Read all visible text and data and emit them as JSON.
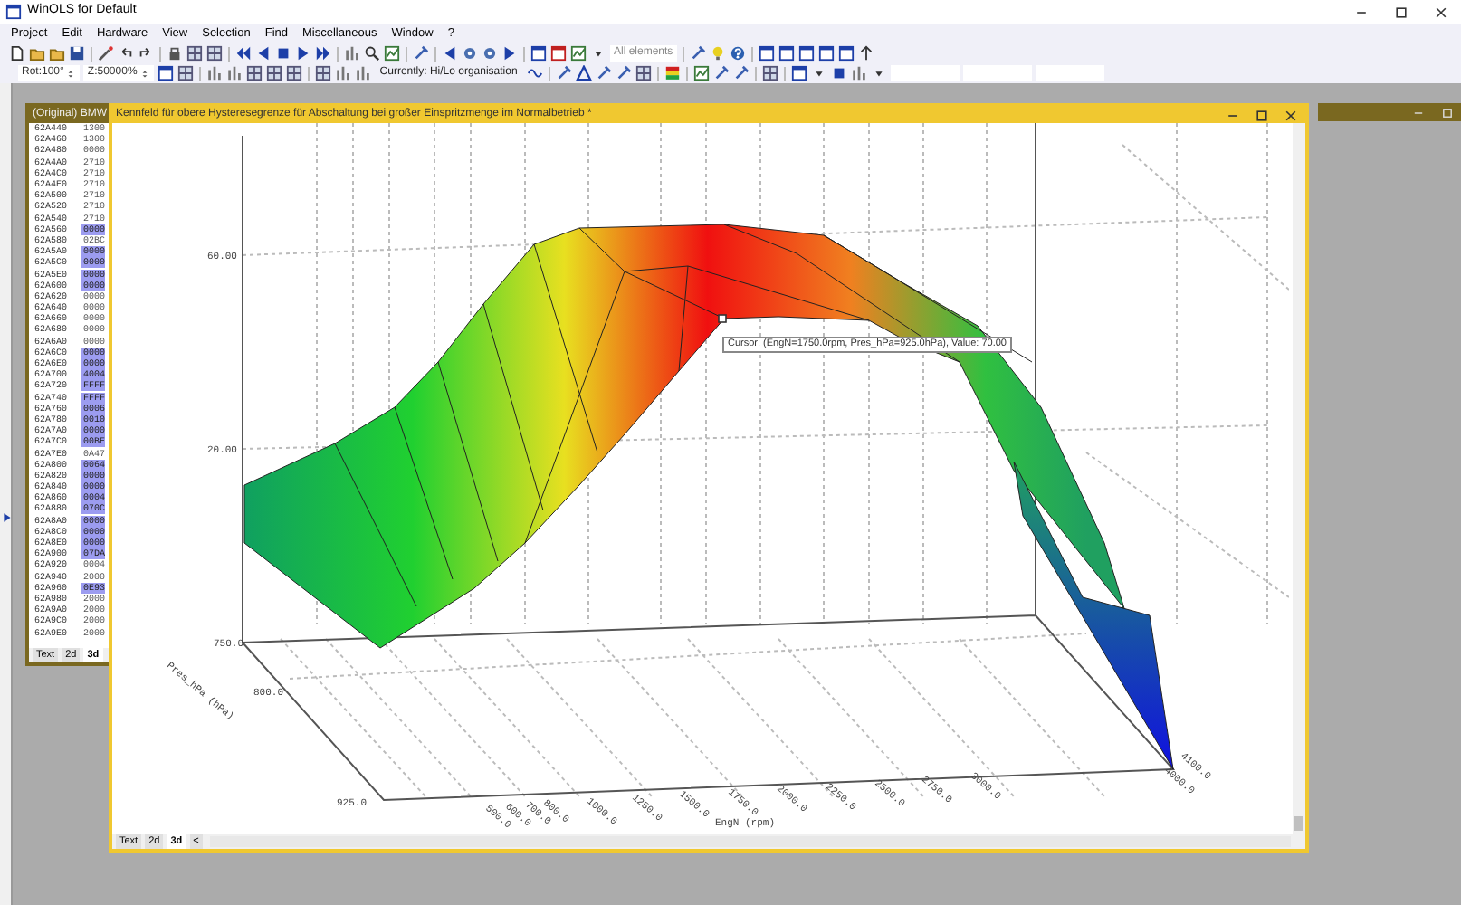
{
  "app": {
    "title": "WinOLS for Default"
  },
  "menu": [
    "Project",
    "Edit",
    "Hardware",
    "View",
    "Selection",
    "Find",
    "Miscellaneous",
    "Window",
    "?"
  ],
  "toolbar": {
    "element_filter": "All elements",
    "rotation": "Rot:100°",
    "zoom": "Z:50000%",
    "organisation": "Currently: Hi/Lo organisation"
  },
  "hex_window": {
    "title": "(Original) BMW",
    "rows": [
      {
        "address": "62A440",
        "value": "1300",
        "selected": false
      },
      {
        "address": "62A460",
        "value": "1300",
        "selected": false
      },
      {
        "address": "62A480",
        "value": "0000",
        "selected": false
      },
      {
        "address": "62A4A0",
        "value": "2710",
        "selected": false
      },
      {
        "address": "62A4C0",
        "value": "2710",
        "selected": false
      },
      {
        "address": "62A4E0",
        "value": "2710",
        "selected": false
      },
      {
        "address": "62A500",
        "value": "2710",
        "selected": false
      },
      {
        "address": "62A520",
        "value": "2710",
        "selected": false
      },
      {
        "address": "62A540",
        "value": "2710",
        "selected": false
      },
      {
        "address": "62A560",
        "value": "0000",
        "selected": true
      },
      {
        "address": "62A580",
        "value": "02BC",
        "selected": false
      },
      {
        "address": "62A5A0",
        "value": "0000",
        "selected": true
      },
      {
        "address": "62A5C0",
        "value": "0000",
        "selected": true
      },
      {
        "address": "62A5E0",
        "value": "0000",
        "selected": true
      },
      {
        "address": "62A600",
        "value": "0000",
        "selected": true
      },
      {
        "address": "62A620",
        "value": "0000",
        "selected": false
      },
      {
        "address": "62A640",
        "value": "0000",
        "selected": false
      },
      {
        "address": "62A660",
        "value": "0000",
        "selected": false
      },
      {
        "address": "62A680",
        "value": "0000",
        "selected": false
      },
      {
        "address": "62A6A0",
        "value": "0000",
        "selected": false
      },
      {
        "address": "62A6C0",
        "value": "0000",
        "selected": true
      },
      {
        "address": "62A6E0",
        "value": "0000",
        "selected": true
      },
      {
        "address": "62A700",
        "value": "4004",
        "selected": true
      },
      {
        "address": "62A720",
        "value": "FFFF",
        "selected": true
      },
      {
        "address": "62A740",
        "value": "FFFF",
        "selected": true
      },
      {
        "address": "62A760",
        "value": "0006",
        "selected": true
      },
      {
        "address": "62A780",
        "value": "0010",
        "selected": true
      },
      {
        "address": "62A7A0",
        "value": "0000",
        "selected": true
      },
      {
        "address": "62A7C0",
        "value": "00BE",
        "selected": true
      },
      {
        "address": "62A7E0",
        "value": "0A47",
        "selected": false
      },
      {
        "address": "62A800",
        "value": "0064",
        "selected": true
      },
      {
        "address": "62A820",
        "value": "0000",
        "selected": true
      },
      {
        "address": "62A840",
        "value": "0000",
        "selected": true
      },
      {
        "address": "62A860",
        "value": "0004",
        "selected": true
      },
      {
        "address": "62A880",
        "value": "070C",
        "selected": true
      },
      {
        "address": "62A8A0",
        "value": "0000",
        "selected": true
      },
      {
        "address": "62A8C0",
        "value": "0000",
        "selected": true
      },
      {
        "address": "62A8E0",
        "value": "0000",
        "selected": true
      },
      {
        "address": "62A900",
        "value": "07DA",
        "selected": true
      },
      {
        "address": "62A920",
        "value": "0004",
        "selected": false
      },
      {
        "address": "62A940",
        "value": "2000",
        "selected": false
      },
      {
        "address": "62A960",
        "value": "0E93",
        "selected": true
      },
      {
        "address": "62A980",
        "value": "2000",
        "selected": false
      },
      {
        "address": "62A9A0",
        "value": "2000",
        "selected": false
      },
      {
        "address": "62A9C0",
        "value": "2000",
        "selected": false
      },
      {
        "address": "62A9E0",
        "value": "2000",
        "selected": false
      }
    ],
    "tabs": [
      {
        "label": "Text",
        "selected": false
      },
      {
        "label": "2d",
        "selected": false
      },
      {
        "label": "3d",
        "selected": true
      }
    ]
  },
  "map_window": {
    "title": "Kennfeld für obere Hysteresegrenze für Abschaltung bei großer Einspritzmenge im Normalbetrieb *",
    "tabs": [
      {
        "label": "Text",
        "selected": false
      },
      {
        "label": "2d",
        "selected": false
      },
      {
        "label": "3d",
        "selected": true
      }
    ],
    "tab_scroll": "<",
    "plot": {
      "z_ticks": [
        "60.00",
        "20.00"
      ],
      "y_ticks": [
        "750.0",
        "800.0",
        "925.0"
      ],
      "y_title": "Pres_hPa (hPa)",
      "x_ticks": [
        "500.0",
        "600.0",
        "700.0",
        "800.0",
        "1000.0",
        "1250.0",
        "1500.0",
        "1750.0",
        "2000.0",
        "2250.0",
        "2500.0",
        "2750.0",
        "3000.0",
        "4000.0",
        "4100.0"
      ],
      "x_title": "EngN (rpm)",
      "tooltip": "Cursor: (EngN=1750.0rpm, Pres_hPa=925.0hPa), Value: 70.00"
    }
  }
}
